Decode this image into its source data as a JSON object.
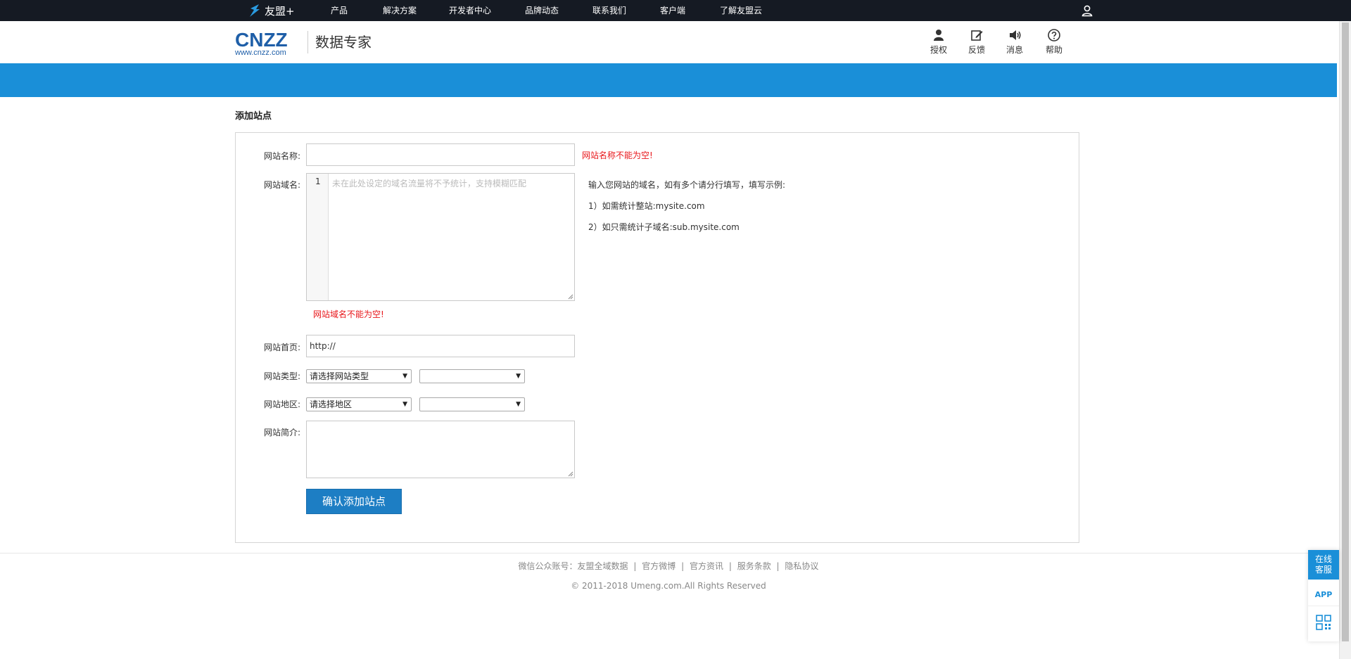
{
  "topnav": {
    "brand": "友盟+",
    "items": [
      "产品",
      "解决方案",
      "开发者中心",
      "品牌动态",
      "联系我们",
      "客户端",
      "了解友盟云"
    ]
  },
  "header": {
    "logo_text": "CNZZ",
    "logo_url": "www.cnzz.com",
    "product_title": "数据专家",
    "tools": [
      {
        "icon": "user-icon",
        "label": "授权"
      },
      {
        "icon": "edit-icon",
        "label": "反馈"
      },
      {
        "icon": "speaker-icon",
        "label": "消息"
      },
      {
        "icon": "help-icon",
        "label": "帮助"
      }
    ]
  },
  "page": {
    "title": "添加站点"
  },
  "form": {
    "site_name_label": "网站名称:",
    "site_name_value": "",
    "site_name_error": "网站名称不能为空!",
    "domain_label": "网站域名:",
    "domain_line_number": "1",
    "domain_placeholder": "未在此处设定的域名流量将不予统计，支持模糊匹配",
    "domain_error": "网站域名不能为空!",
    "domain_help": [
      "输入您网站的域名，如有多个请分行填写，填写示例:",
      "1）如需统计整站:mysite.com",
      "2）如只需统计子域名:sub.mysite.com"
    ],
    "homepage_label": "网站首页:",
    "homepage_value": "http://",
    "type_label": "网站类型:",
    "type_select": "请选择网站类型",
    "type_sub_select": "",
    "region_label": "网站地区:",
    "region_select": "请选择地区",
    "region_sub_select": "",
    "intro_label": "网站简介:",
    "submit_label": "确认添加站点"
  },
  "footer": {
    "links": [
      "微信公众账号：友盟全域数据",
      "官方微博",
      "官方资讯",
      "服务条款",
      "隐私协议"
    ],
    "separator": "|",
    "copyright": "© 2011-2018 Umeng.com.All Rights Reserved"
  },
  "float_widget": {
    "online_service": "在线客服",
    "app": "APP"
  },
  "colors": {
    "topnav_bg": "#151a23",
    "banner_blue": "#1a8fd8",
    "brand_blue": "#1f5fa8",
    "button_blue": "#1d7ec4",
    "error_red": "#e8161a"
  }
}
